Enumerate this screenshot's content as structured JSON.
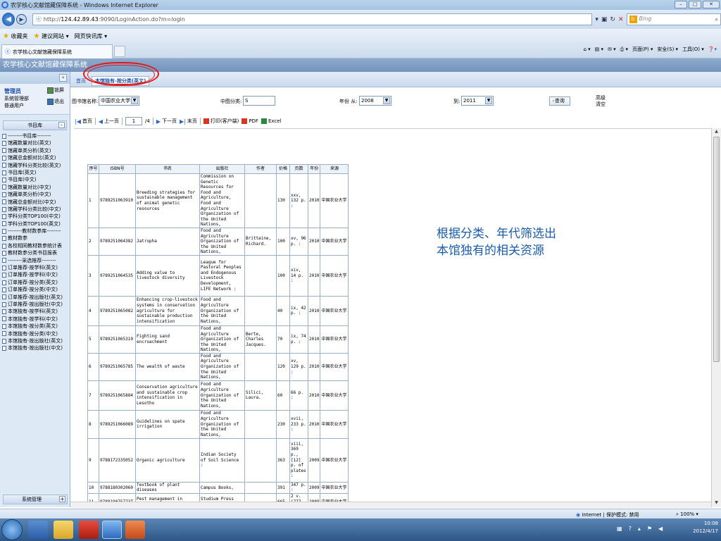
{
  "window": {
    "title": "农学核心文献馆藏保障系统 - Windows Internet Explorer",
    "min": "–",
    "max": "□",
    "close": "✕"
  },
  "browser": {
    "url_prefix": "http://",
    "url_host": "124.42.89.43",
    "url_path": ":9090/LoginAction.do?m=login",
    "search_placeholder": "Bing",
    "search_engine": "b",
    "favorites": "收藏夹",
    "fav_item1": "建议网站 ▾",
    "fav_item2": "网页快讯库 ▾",
    "tab_title": "农学核心文献馆藏保障系统",
    "cmd_page": "页面(P) ▾",
    "cmd_safety": "安全(S) ▾",
    "cmd_tools": "工具(O) ▾"
  },
  "app": {
    "header_title": "农学核心文献馆藏保障系统",
    "collapse": "«"
  },
  "user": {
    "name": "管理员",
    "role1": "系统管理部",
    "role2": "普通用户",
    "btn_lock": "锁屏",
    "btn_logout": "退出"
  },
  "sidebar": {
    "section_title": "书目库",
    "items": [
      "--------书目库--------",
      "馆藏数量对比(英文)",
      "馆藏单类分析(英文)",
      "馆藏总金额对比(英文)",
      "馆藏学科分类比较(英文)",
      "书目库(英文)",
      "书目库(中文)",
      "馆藏数量对比(中文)",
      "馆藏单类分析(中文)",
      "馆藏总金额对比(中文)",
      "馆藏学科分类比较(中文)",
      "学科分类TOP100(中文)",
      "学科分类TOP100(英文)",
      "--------教材数参库--------",
      "教材数参",
      "各校相同教材数参统计表",
      "教材数参分类书目报表",
      "--------采选推荐--------",
      "订单推荐-按学科(英文)",
      "订单推荐-按学科(中文)",
      "订单推荐-按分类(英文)",
      "订单推荐-按分类(中文)",
      "订单推荐-按出版社(英文)",
      "订单推荐-按出版社(中文)",
      "本馆独有-按学科(英文)",
      "本馆独有-按学科(中文)",
      "本馆独有-按分类(英文)",
      "本馆独有-按分类(中文)",
      "本馆独有-按出版社(英文)",
      "本馆独有-按出版社(中文)"
    ],
    "system_mgmt": "系统管理"
  },
  "main": {
    "home_tab": "首页",
    "active_tab": "本馆独有-按分类(英文)",
    "filters": {
      "library_label": "图书馆名称:",
      "library_value": "中国农业大学",
      "class_label": "中图分类:",
      "class_value": "S",
      "year_from_label": "年份 从:",
      "year_from_value": "2008",
      "year_to_label": "到:",
      "year_to_value": "2011",
      "query_button": "查询",
      "advanced": "高级",
      "clear": "清空"
    },
    "pager": {
      "first": "首页",
      "prev": "上一页",
      "page": "1",
      "total": "/4",
      "next": "下一页",
      "last": "末页",
      "print": "打印(客户端)",
      "pdf": "PDF",
      "excel": "Excel"
    },
    "table": {
      "headers": [
        "序号",
        "ISBN号",
        "书名",
        "出版社",
        "作者",
        "价格",
        "页数",
        "年份",
        "来源"
      ],
      "rows": [
        [
          "1",
          "9789251063910",
          "Breeding strategies for sustainable management of animal genetic resources",
          "Commission on Genetic Resources for Food and Agriculture, Food and Agriculture Organization of the United Nations,",
          "",
          "130",
          "xxv, 132 p. :",
          "2010",
          "中国农业大学"
        ],
        [
          "2",
          "9789251064382",
          "Jatropha",
          "Food and Agriculture Organization of the United Nations,",
          "Brittaine, Richard.",
          "100",
          "xv, 96 p. :",
          "2010",
          "中国农业大学"
        ],
        [
          "3",
          "9789251064535",
          "Adding value to livestock diversity",
          "League for Pastoral Peoples and Endogenous Livestock Development, LIFE Network :",
          "",
          "100",
          "xiv, 14 p. :",
          "2010",
          "中国农业大学"
        ],
        [
          "4",
          "9789251065082",
          "Enhancing crop-livestock systems in conservation agriculture for sustainable production intensification",
          "Food and Agriculture Organization of the United Nations,",
          "",
          "40",
          "ix, 42 p. :",
          "2010",
          "中国农业大学"
        ],
        [
          "5",
          "9789251065310",
          "Fighting sand encroachment",
          "Food and Agriculture Organization of the United Nations,",
          "Berte, Charles Jacques.",
          "70",
          "ix, 74 p. :",
          "2010",
          "中国农业大学"
        ],
        [
          "6",
          "9789251065785",
          "The wealth of waste",
          "Food and Agriculture Organization of the United Nations,",
          "",
          "120",
          "xv, 129 p. :",
          "2010",
          "中国农业大学"
        ],
        [
          "7",
          "9789251065884",
          "Conservation agriculture and sustainable crop intensification in Lesotho",
          "Food and Agriculture Organization of the United Nations,",
          "Silici, Laura.",
          "60",
          "66 p. :",
          "2010",
          "中国农业大学"
        ],
        [
          "8",
          "9789251066089",
          "Guidelines on spate irrigation",
          "Food and Agriculture Organization of the United Nations,",
          "",
          "230",
          "xvii, 233 p. :",
          "2010",
          "中国农业大学"
        ],
        [
          "9",
          "9788172335052",
          "Organic agriculture",
          "Indian Society of Soil Science :",
          "",
          "363",
          "viii, 369 p., [12] p. of plates :",
          "2009",
          "中国农业大学"
        ],
        [
          "10",
          "9788180302060",
          "Textbook of plant diseases",
          "Campus Books,",
          "",
          "391",
          "347 p. :",
          "2009",
          "中国农业大学"
        ],
        [
          "11",
          "978819075773T",
          "Pest management in vegetables",
          "Studium Press Pvt. Ltd.,",
          "",
          "665",
          "2 v. (777 p.) :",
          "2009",
          "中国农业大学"
        ],
        [
          "",
          "",
          "Socio-economic impacts of no",
          "Food and Agricultur",
          "",
          "",
          "",
          "",
          ""
        ]
      ]
    },
    "annotation_line1": "根据分类、年代筛选出",
    "annotation_line2": "本馆独有的相关资源"
  },
  "status": {
    "zone": "Internet | 保护模式: 禁用",
    "zoom": "100%"
  },
  "taskbar": {
    "time": "10:08",
    "date": "2012/4/17"
  }
}
